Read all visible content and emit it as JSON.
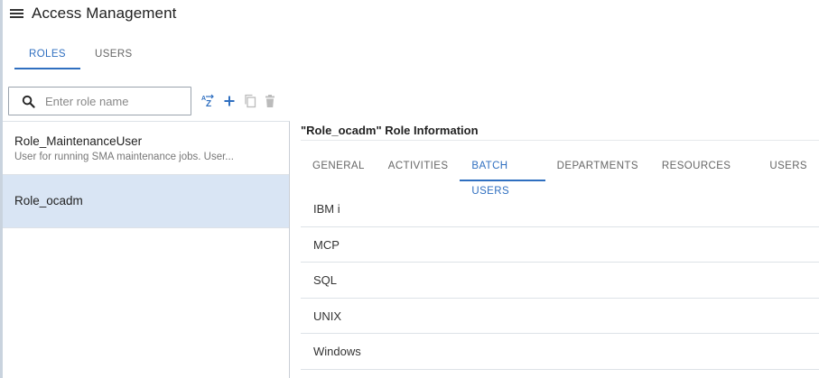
{
  "header": {
    "title": "Access Management",
    "menu_icon": "hamburger-menu-icon"
  },
  "main_tabs": [
    {
      "label": "ROLES",
      "active": true
    },
    {
      "label": "USERS",
      "active": false
    }
  ],
  "search": {
    "placeholder": "Enter role name",
    "value": "",
    "icon": "search-icon"
  },
  "toolbar": {
    "sort_label": "Z",
    "sort_top": "A",
    "icons": [
      "sort-az-icon",
      "add-icon",
      "copy-icon",
      "delete-icon"
    ]
  },
  "roles": [
    {
      "name": "Role_MaintenanceUser",
      "description": "User for running SMA maintenance jobs. User...",
      "selected": false
    },
    {
      "name": "Role_ocadm",
      "description": "",
      "selected": true
    }
  ],
  "info": {
    "title": "\"Role_ocadm\" Role Information"
  },
  "sub_tabs": [
    {
      "label": "GENERAL",
      "active": false
    },
    {
      "label": "ACTIVITIES",
      "active": false
    },
    {
      "label": "BATCH USERS",
      "active": true
    },
    {
      "label": "DEPARTMENTS",
      "active": false
    },
    {
      "label": "RESOURCES",
      "active": false
    },
    {
      "label": "USERS",
      "active": false
    }
  ],
  "batch_users": [
    "IBM i",
    "MCP",
    "SQL",
    "UNIX",
    "Windows"
  ],
  "colors": {
    "accent": "#2f6fc0",
    "selected_bg": "#d9e5f4",
    "divider": "#dde2e7"
  }
}
